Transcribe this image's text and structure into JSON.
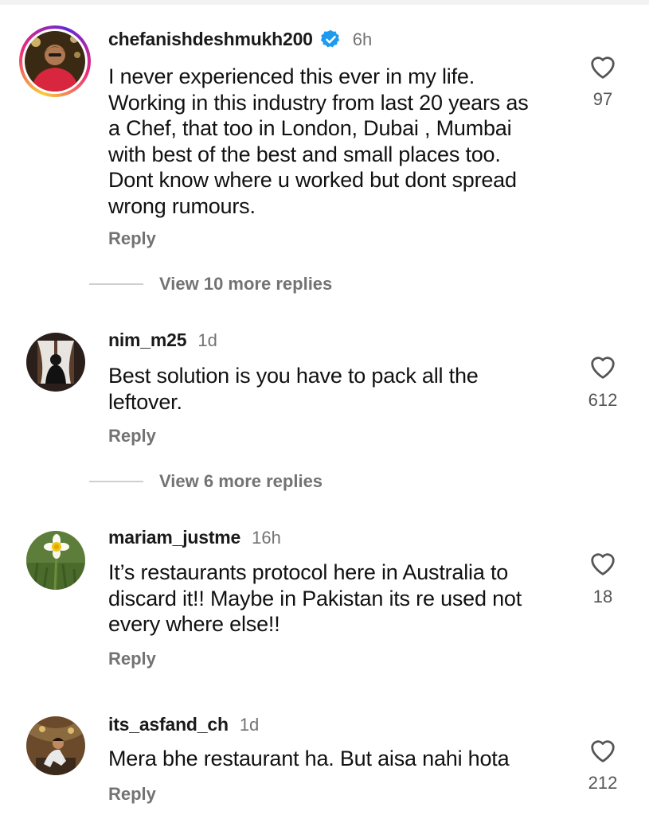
{
  "comments": [
    {
      "username": "chefanishdeshmukh200",
      "verified": true,
      "time": "6h",
      "lines": [
        "I never experienced this ever in my life.",
        "Working in this industry from last 20 years as",
        "a Chef, that too in London, Dubai , Mumbai",
        "with best of the best and small places too.",
        "Dont know where u worked but dont spread",
        "wrong rumours."
      ],
      "reply_label": "Reply",
      "likes": "97",
      "view_replies": "View 10 more replies",
      "avatar": "man-in-red-outfit-photo"
    },
    {
      "username": "nim_m25",
      "verified": false,
      "time": "1d",
      "lines": [
        "Best solution is you have to pack all the",
        "leftover."
      ],
      "reply_label": "Reply",
      "likes": "612",
      "view_replies": "View 6 more replies",
      "avatar": "woman-in-window-photo"
    },
    {
      "username": "mariam_justme",
      "verified": false,
      "time": "16h",
      "lines": [
        "It’s restaurants protocol here in Australia to",
        "discard it!! Maybe in Pakistan its re used not",
        "every where else!!"
      ],
      "reply_label": "Reply",
      "likes": "18",
      "avatar": "daffodil-flower-photo"
    },
    {
      "username": "its_asfand_ch",
      "verified": false,
      "time": "1d",
      "lines": [
        "Mera bhe restaurant ha. But aisa nahi hota"
      ],
      "reply_label": "Reply",
      "likes": "212",
      "avatar": "man-sitting-photo"
    }
  ],
  "icons": {
    "like": "heart-outline-icon",
    "verified": "verified-badge-icon"
  },
  "colors": {
    "verified": "#1d9bf0",
    "muted": "#737373",
    "text": "#111111"
  }
}
